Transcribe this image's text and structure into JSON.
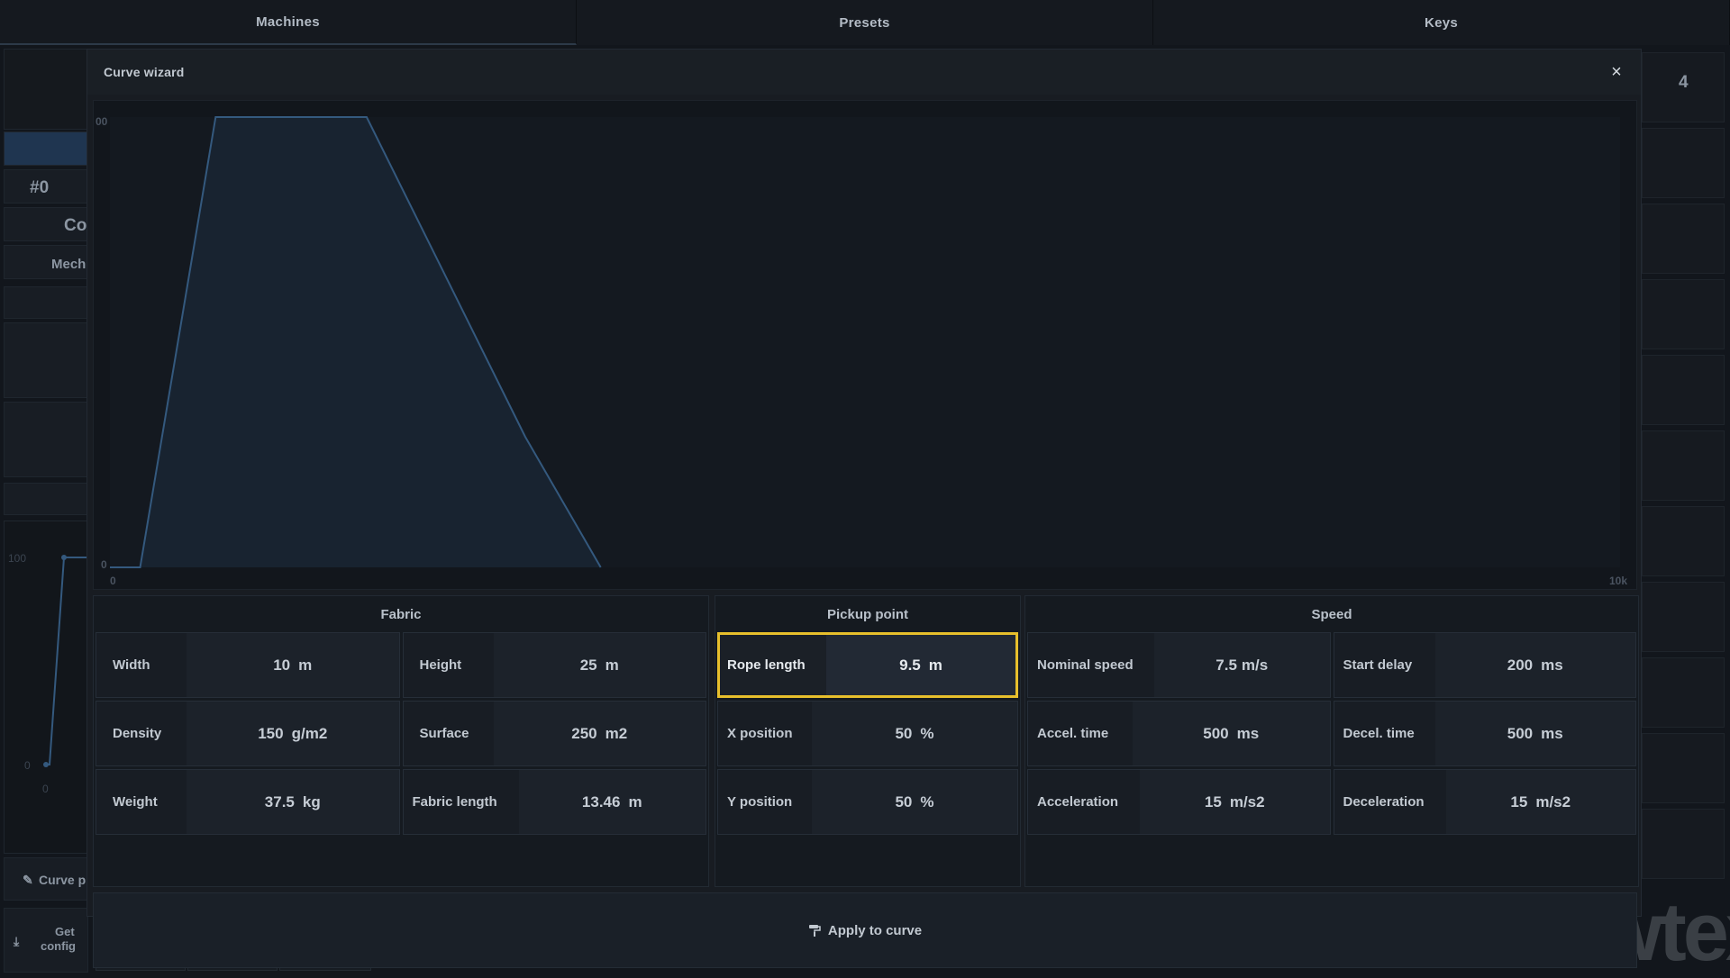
{
  "tabs": [
    {
      "label": "Machines"
    },
    {
      "label": "Presets"
    },
    {
      "label": "Keys"
    }
  ],
  "background": {
    "id_label": "#0",
    "co_label": "Co",
    "mech_label": "Mech",
    "mini_chart": {
      "y_top": "100",
      "y_bottom": "0",
      "x_start": "0"
    },
    "curve_button": "Curve p",
    "get_config_line1": "Get",
    "get_config_line2": "config",
    "right_number": "4",
    "logo_text": "showtex"
  },
  "modal": {
    "title": "Curve wizard",
    "close_label": "×",
    "apply_label": "Apply to curve",
    "groups": [
      {
        "title": "Fabric",
        "params": [
          {
            "label": "Width",
            "value": "10",
            "unit": "m"
          },
          {
            "label": "Height",
            "value": "25",
            "unit": "m"
          },
          {
            "label": "Density",
            "value": "150",
            "unit": "g/m2"
          },
          {
            "label": "Surface",
            "value": "250",
            "unit": "m2"
          },
          {
            "label": "Weight",
            "value": "37.5",
            "unit": "kg"
          },
          {
            "label": "Fabric length",
            "value": "13.46",
            "unit": "m"
          }
        ]
      },
      {
        "title": "Pickup point",
        "params": [
          {
            "label": "Rope length",
            "value": "9.5",
            "unit": "m",
            "selected": true
          },
          {
            "label": "X position",
            "value": "50",
            "unit": "%"
          },
          {
            "label": "Y position",
            "value": "50",
            "unit": "%"
          }
        ]
      },
      {
        "title": "Speed",
        "params": [
          {
            "label": "Nominal speed",
            "value": "7.5",
            "unit": "m/s"
          },
          {
            "label": "Start delay",
            "value": "200",
            "unit": "ms"
          },
          {
            "label": "Accel. time",
            "value": "500",
            "unit": "ms"
          },
          {
            "label": "Decel. time",
            "value": "500",
            "unit": "ms"
          },
          {
            "label": "Acceleration",
            "value": "15",
            "unit": "m/s2"
          },
          {
            "label": "Deceleration",
            "value": "15",
            "unit": "m/s2"
          }
        ]
      }
    ]
  },
  "chart_data": {
    "type": "area",
    "x": [
      0,
      200,
      700,
      1700,
      2750,
      3250
    ],
    "y": [
      0,
      0,
      100,
      100,
      29,
      0
    ],
    "xlim": [
      0,
      10000
    ],
    "ylim": [
      0,
      100
    ],
    "tick_labels": {
      "x_start": "0",
      "x_end": "10k",
      "y_top": "00",
      "y_bottom": "0"
    },
    "line_color": "#34597e",
    "fill_color": "#182330"
  }
}
